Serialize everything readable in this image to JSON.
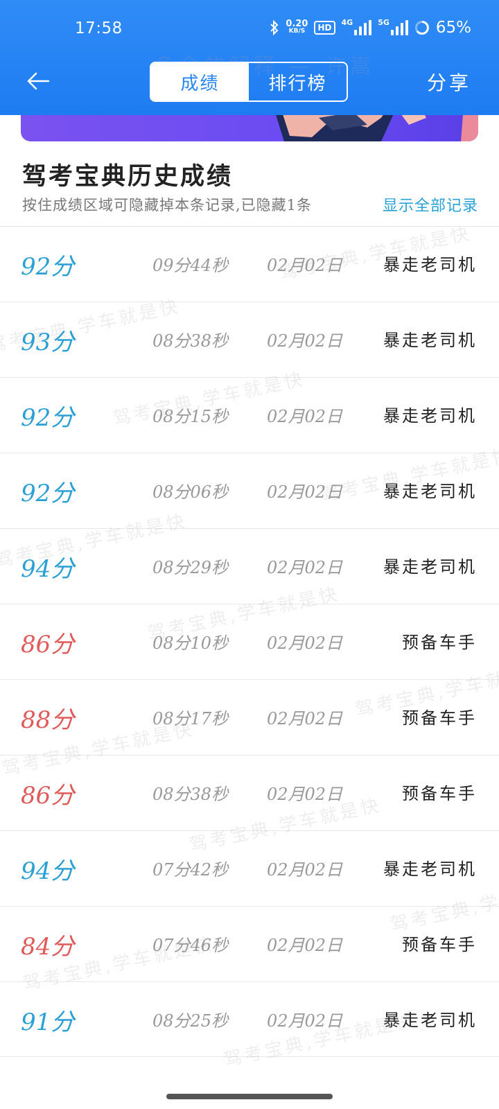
{
  "status_bar": {
    "time": "17:58",
    "speed_value": "0.20",
    "speed_unit": "KB/S",
    "hd_badge": "HD",
    "network_1": "4G",
    "network_2": "5G",
    "battery": "65%"
  },
  "header": {
    "watermark": "多余的解释 — 许嵩",
    "tabs": [
      {
        "label": "成绩",
        "active": true
      },
      {
        "label": "排行榜",
        "active": false
      }
    ],
    "share_label": "分享",
    "back_icon": "arrow-left-icon"
  },
  "section": {
    "title": "驾考宝典历史成绩",
    "hint": "按住成绩区域可隐藏掉本条记录,已隐藏1条",
    "show_all": "显示全部记录"
  },
  "records": [
    {
      "score": "92分",
      "duration": "09分44秒",
      "date": "02月02日",
      "level": "暴走老司机",
      "pass": true
    },
    {
      "score": "93分",
      "duration": "08分38秒",
      "date": "02月02日",
      "level": "暴走老司机",
      "pass": true
    },
    {
      "score": "92分",
      "duration": "08分15秒",
      "date": "02月02日",
      "level": "暴走老司机",
      "pass": true
    },
    {
      "score": "92分",
      "duration": "08分06秒",
      "date": "02月02日",
      "level": "暴走老司机",
      "pass": true
    },
    {
      "score": "94分",
      "duration": "08分29秒",
      "date": "02月02日",
      "level": "暴走老司机",
      "pass": true
    },
    {
      "score": "86分",
      "duration": "08分10秒",
      "date": "02月02日",
      "level": "预备车手",
      "pass": false
    },
    {
      "score": "88分",
      "duration": "08分17秒",
      "date": "02月02日",
      "level": "预备车手",
      "pass": false
    },
    {
      "score": "86分",
      "duration": "08分38秒",
      "date": "02月02日",
      "level": "预备车手",
      "pass": false
    },
    {
      "score": "94分",
      "duration": "07分42秒",
      "date": "02月02日",
      "level": "暴走老司机",
      "pass": true
    },
    {
      "score": "84分",
      "duration": "07分46秒",
      "date": "02月02日",
      "level": "预备车手",
      "pass": false
    },
    {
      "score": "91分",
      "duration": "08分25秒",
      "date": "02月02日",
      "level": "暴走老司机",
      "pass": true
    }
  ],
  "watermark_text": "驾考宝典,学车就是快",
  "colors": {
    "header": "#1e7cf2",
    "pass_score": "#2a9fd6",
    "fail_score": "#e05a5a",
    "link": "#28a0d8"
  }
}
